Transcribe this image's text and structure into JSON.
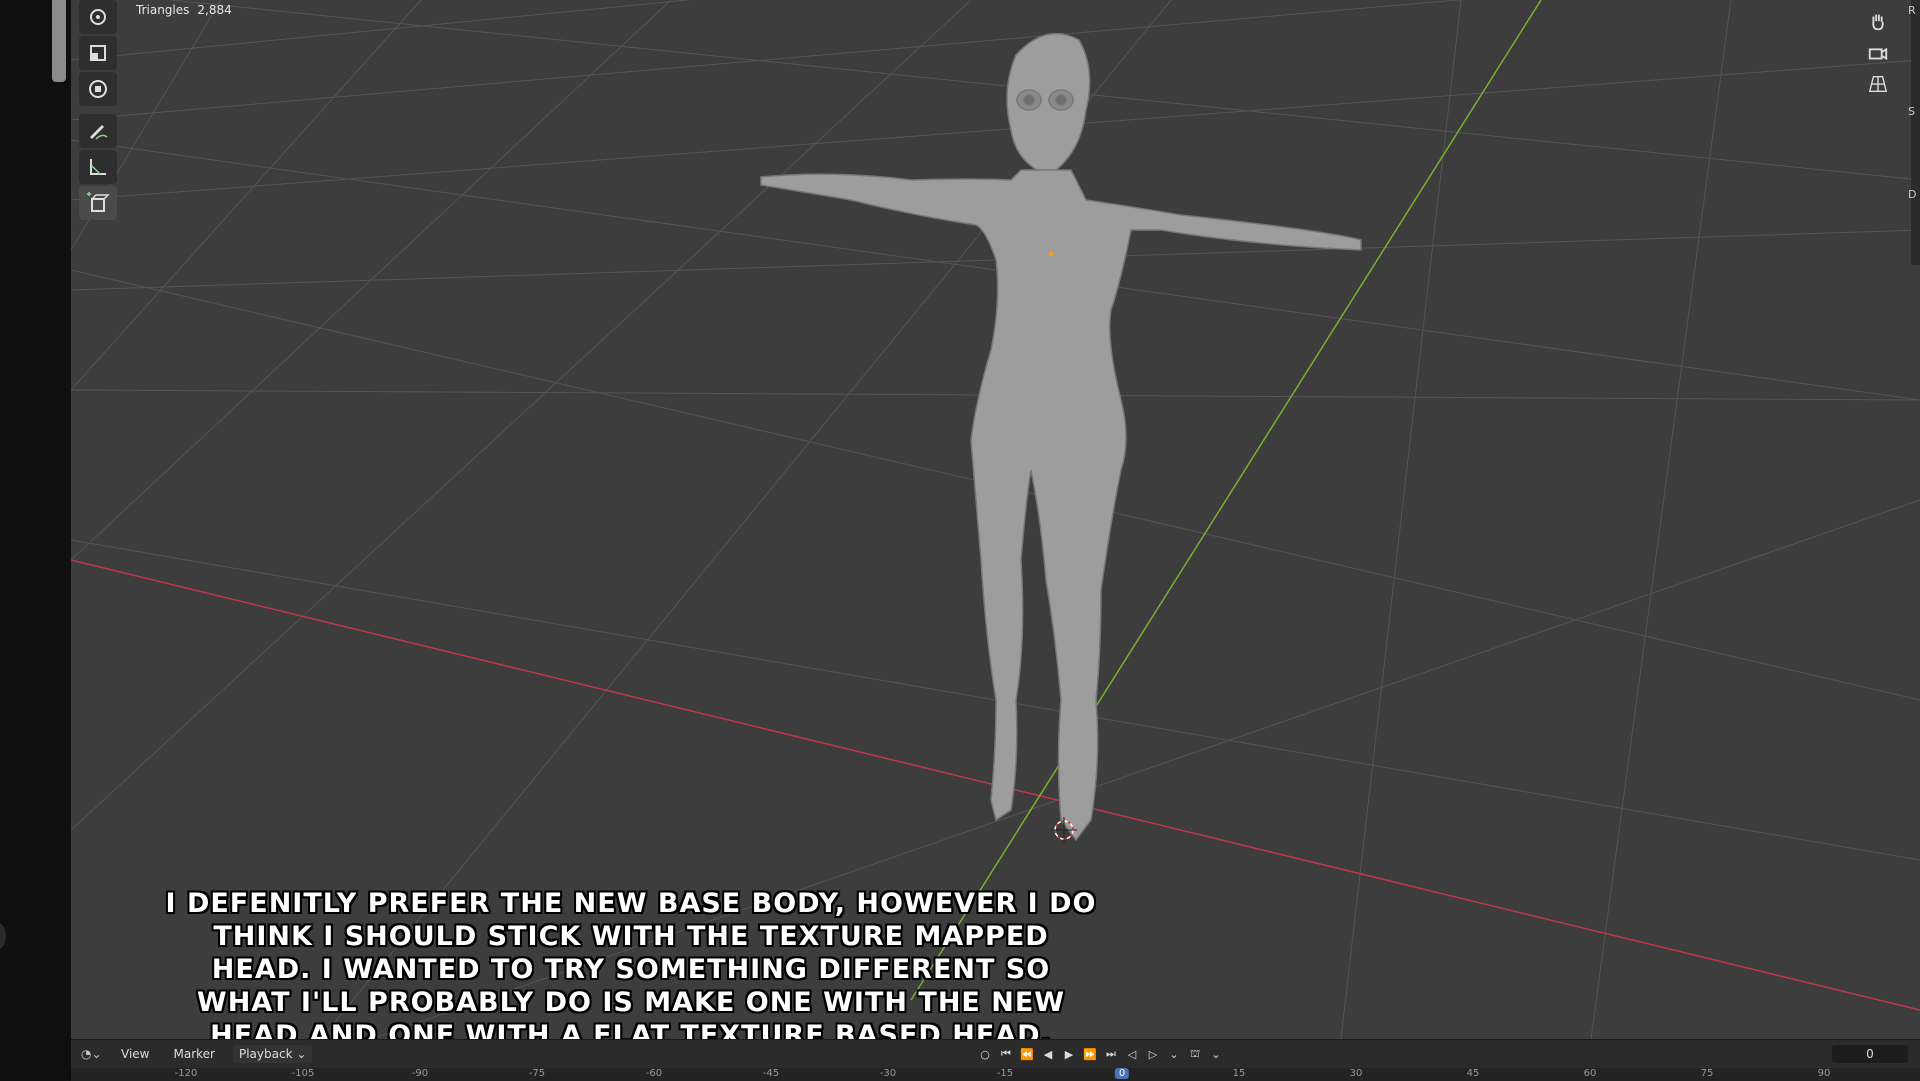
{
  "stats": {
    "label": "Triangles",
    "value": "2,884"
  },
  "caption": "I DEFENITLY PREFER THE NEW BASE BODY, HOWEVER I DO THINK I SHOULD STICK WITH THE TEXTURE MAPPED HEAD. I WANTED TO TRY SOMETHING DIFFERENT SO WHAT I'LL PROBABLY DO IS MAKE ONE WITH THE NEW HEAD AND ONE WITH A FLAT TEXTURE BASED HEAD.",
  "toolbar": [
    "rotate-icon",
    "scale-icon",
    "transform-icon",
    "annotate-icon",
    "measure-icon",
    "add-cube-icon"
  ],
  "navigation": [
    "hand-pan-icon",
    "camera-icon",
    "grid-perspective-icon"
  ],
  "timeline": {
    "view": "View",
    "marker": "Marker",
    "playback": "Playback",
    "current_frame": "0",
    "ticks": [
      "-120",
      "-105",
      "-90",
      "-75",
      "-60",
      "-45",
      "-30",
      "-15",
      "0",
      "15",
      "30",
      "45",
      "60",
      "75",
      "90"
    ]
  },
  "colors": {
    "viewport_bg": "#3d3d3d",
    "x_axis": "#c0384b",
    "y_axis": "#78b030",
    "frame_indicator": "#4772b3"
  }
}
